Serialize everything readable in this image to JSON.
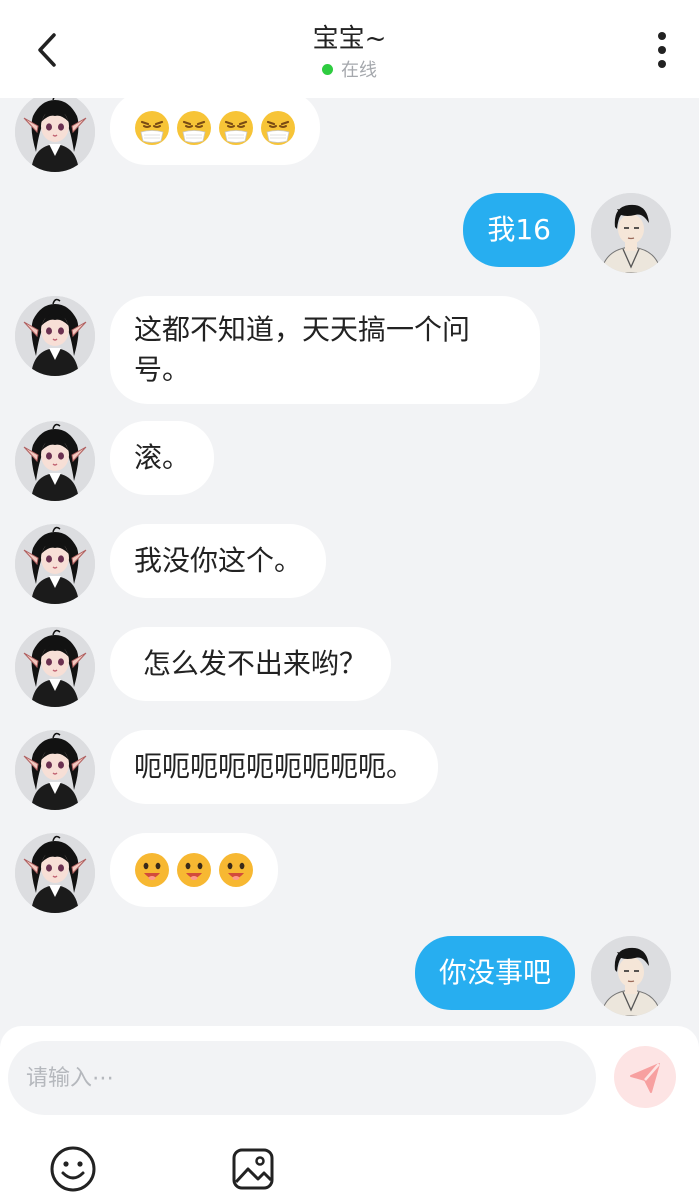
{
  "header": {
    "title": "宝宝~",
    "status": "在线",
    "status_color": "#2ecc40",
    "back_icon": "chevron-left-icon",
    "more_icon": "more-vertical-icon"
  },
  "messages": [
    {
      "side": "left",
      "type": "emoji",
      "emoji": "mask-face",
      "count": 4
    },
    {
      "side": "right",
      "type": "text",
      "text": "我16"
    },
    {
      "side": "left",
      "type": "text",
      "text": "这都不知道，天天搞一个问号。"
    },
    {
      "side": "left",
      "type": "text",
      "text": "滚。"
    },
    {
      "side": "left",
      "type": "text",
      "text": "我没你这个。"
    },
    {
      "side": "left",
      "type": "text",
      "text": " 怎么发不出来哟？"
    },
    {
      "side": "left",
      "type": "text",
      "text": "呃呃呃呃呃呃呃呃呃。"
    },
    {
      "side": "left",
      "type": "emoji",
      "emoji": "smile-face",
      "count": 3
    },
    {
      "side": "right",
      "type": "text",
      "text": "你没事吧"
    }
  ],
  "input": {
    "placeholder": "请输入⋯",
    "value": ""
  },
  "toolbar": {
    "send_icon": "send-icon",
    "emoji_icon": "smiley-icon",
    "image_icon": "image-icon"
  },
  "colors": {
    "accent": "#27aef0",
    "background": "#f2f3f5",
    "send_button": "#fde4e4",
    "send_icon": "#f7a0a0"
  }
}
